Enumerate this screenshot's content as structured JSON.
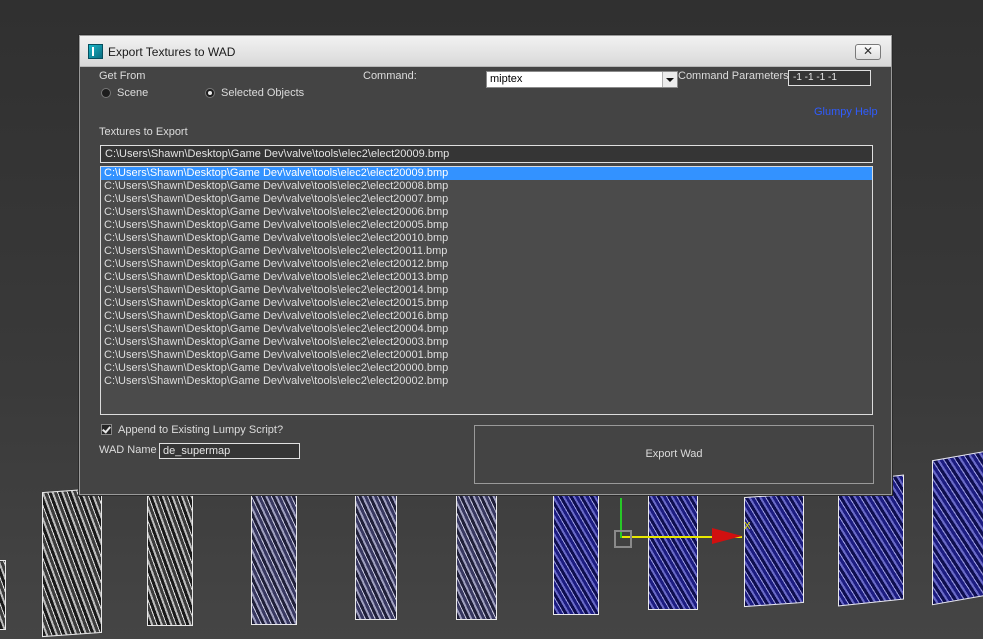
{
  "window": {
    "title": "Export Textures to WAD",
    "close_symbol": "✕"
  },
  "get_from": {
    "label": "Get From",
    "options": [
      "Scene",
      "Selected Objects"
    ],
    "selected": "Selected Objects"
  },
  "command": {
    "label": "Command:",
    "value": "miptex"
  },
  "command_parameters": {
    "label": "Command Parameters",
    "value": "-1 -1 -1 -1"
  },
  "help_link": "Glumpy Help",
  "textures": {
    "label": "Textures to Export",
    "current_path": "C:\\Users\\Shawn\\Desktop\\Game Dev\\valve\\tools\\elec2\\elect20009.bmp",
    "items": [
      "C:\\Users\\Shawn\\Desktop\\Game Dev\\valve\\tools\\elec2\\elect20009.bmp",
      "C:\\Users\\Shawn\\Desktop\\Game Dev\\valve\\tools\\elec2\\elect20008.bmp",
      "C:\\Users\\Shawn\\Desktop\\Game Dev\\valve\\tools\\elec2\\elect20007.bmp",
      "C:\\Users\\Shawn\\Desktop\\Game Dev\\valve\\tools\\elec2\\elect20006.bmp",
      "C:\\Users\\Shawn\\Desktop\\Game Dev\\valve\\tools\\elec2\\elect20005.bmp",
      "C:\\Users\\Shawn\\Desktop\\Game Dev\\valve\\tools\\elec2\\elect20010.bmp",
      "C:\\Users\\Shawn\\Desktop\\Game Dev\\valve\\tools\\elec2\\elect20011.bmp",
      "C:\\Users\\Shawn\\Desktop\\Game Dev\\valve\\tools\\elec2\\elect20012.bmp",
      "C:\\Users\\Shawn\\Desktop\\Game Dev\\valve\\tools\\elec2\\elect20013.bmp",
      "C:\\Users\\Shawn\\Desktop\\Game Dev\\valve\\tools\\elec2\\elect20014.bmp",
      "C:\\Users\\Shawn\\Desktop\\Game Dev\\valve\\tools\\elec2\\elect20015.bmp",
      "C:\\Users\\Shawn\\Desktop\\Game Dev\\valve\\tools\\elec2\\elect20016.bmp",
      "C:\\Users\\Shawn\\Desktop\\Game Dev\\valve\\tools\\elec2\\elect20004.bmp",
      "C:\\Users\\Shawn\\Desktop\\Game Dev\\valve\\tools\\elec2\\elect20003.bmp",
      "C:\\Users\\Shawn\\Desktop\\Game Dev\\valve\\tools\\elec2\\elect20001.bmp",
      "C:\\Users\\Shawn\\Desktop\\Game Dev\\valve\\tools\\elec2\\elect20000.bmp",
      "C:\\Users\\Shawn\\Desktop\\Game Dev\\valve\\tools\\elec2\\elect20002.bmp"
    ],
    "selected_index": 0
  },
  "append": {
    "label": "Append to Existing Lumpy Script?",
    "checked": true
  },
  "wad_name": {
    "label": "WAD Name",
    "value": "de_supermap"
  },
  "export_button": "Export Wad",
  "viewport": {
    "gizmo_axis_label": "X",
    "colors": {
      "selection": "#3392ff",
      "help_link": "#2f5cff",
      "gizmo_x": "#e8e800",
      "gizmo_y": "#27c827",
      "gizmo_arrow": "#d01010"
    }
  }
}
